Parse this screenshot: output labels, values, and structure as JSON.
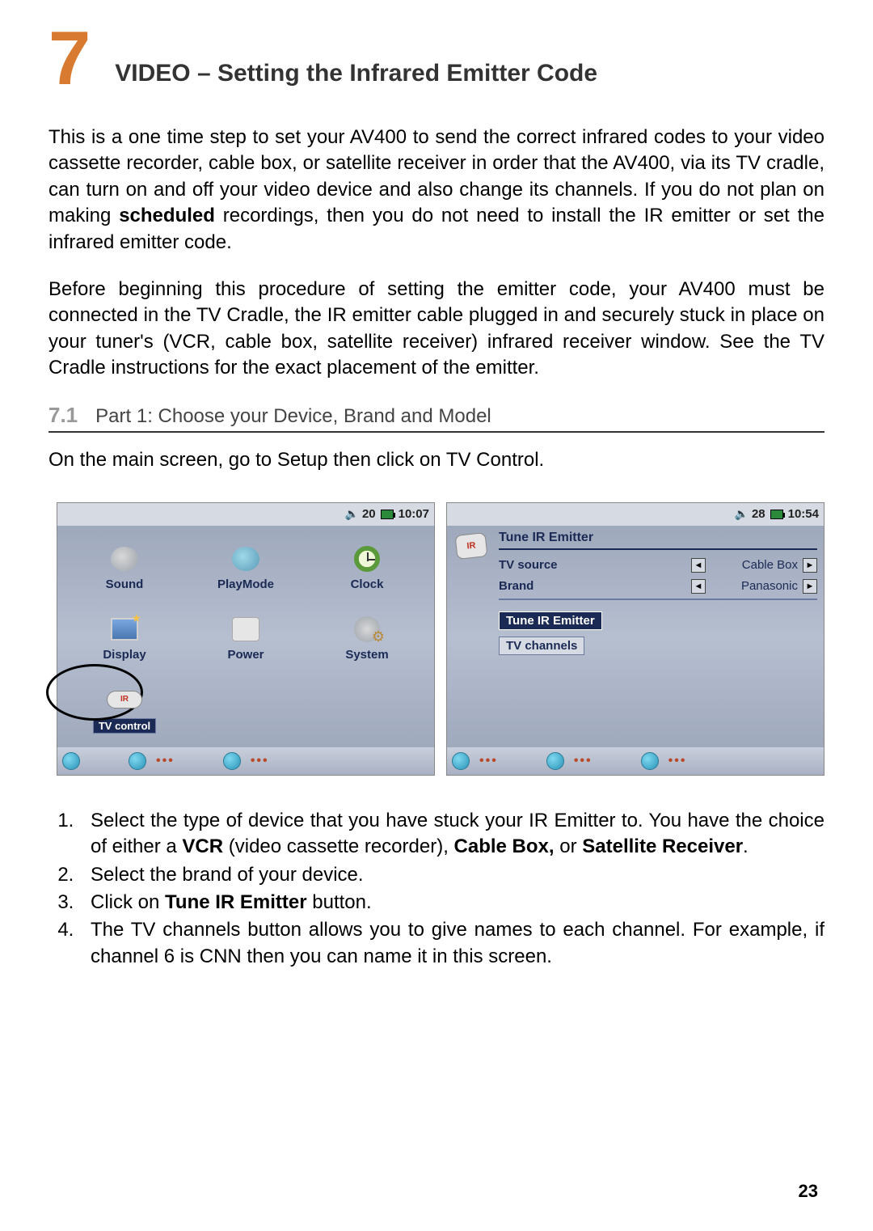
{
  "chapter": {
    "number": "7",
    "title": "VIDEO – Setting the Infrared Emitter Code"
  },
  "para1": "This is a one time step to set your AV400 to send the correct infrared codes to your video cassette recorder, cable box, or satellite receiver in order that the AV400, via its TV cradle, can turn on and off your video device and also change its channels. If you do not plan on making ",
  "para1_bold": "scheduled",
  "para1_tail": " recordings, then you do not need to install the IR emitter or set the infrared emitter code.",
  "para2": "Before beginning this procedure of setting the emitter code, your AV400 must be connected in the TV Cradle, the IR emitter cable plugged in and securely stuck in place on your tuner's (VCR, cable box, satellite receiver) infrared receiver window. See the TV Cradle instructions for the exact placement of the emitter.",
  "sub": {
    "num": "7.1",
    "title": "Part 1: Choose your Device, Brand and Model"
  },
  "line1": "On the main screen, go to Setup then click on TV Control.",
  "screen1": {
    "status_left": "20",
    "status_time": "10:07",
    "cells": {
      "sound": "Sound",
      "playmode": "PlayMode",
      "clock": "Clock",
      "display": "Display",
      "power": "Power",
      "system": "System",
      "tvcontrol": "TV control"
    }
  },
  "screen2": {
    "status_left": "28",
    "status_time": "10:54",
    "title": "Tune IR Emitter",
    "rows": [
      {
        "label": "TV source",
        "value": "Cable Box"
      },
      {
        "label": "Brand",
        "value": "Panasonic"
      }
    ],
    "btn_tune": "Tune IR Emitter",
    "btn_channels": "TV channels"
  },
  "steps": {
    "s1a": "Select the type of device that you have stuck your IR Emitter to. You have the choice of either a ",
    "s1_vcr": "VCR",
    "s1b": " (video cassette recorder), ",
    "s1_cable": "Cable Box,",
    "s1c": " or ",
    "s1_sat": "Satellite Receiver",
    "s1d": ".",
    "s2": "Select the brand of your device.",
    "s3a": "Click on ",
    "s3_bold": "Tune IR Emitter",
    "s3b": " button.",
    "s4": "The TV channels button allows you to give names to each channel. For example, if channel 6 is CNN then you can name it in this screen."
  },
  "page": "23"
}
